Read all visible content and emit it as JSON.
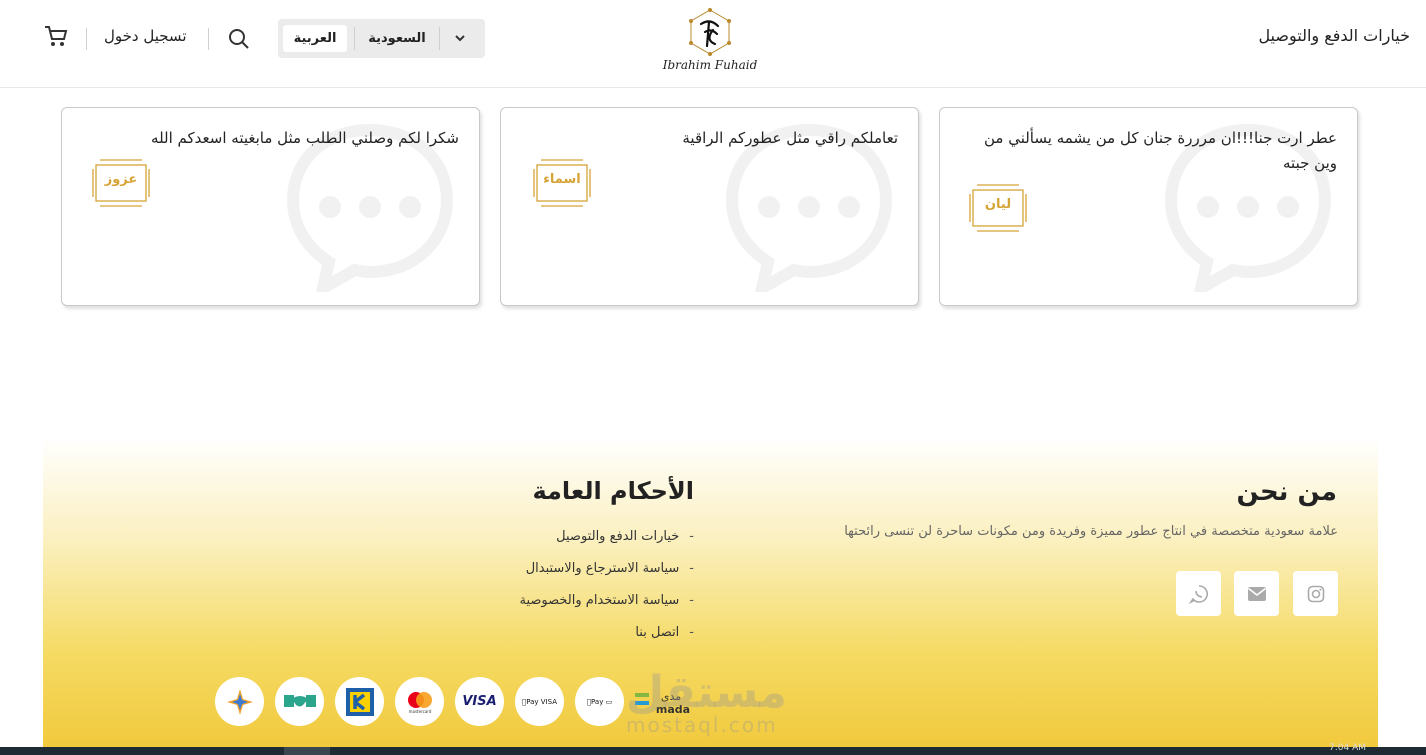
{
  "header": {
    "title": "خيارات الدفع والتوصيل",
    "logo_text": "Ibrahim Fuhaid",
    "language": "العربية",
    "country": "السعودية",
    "login": "تسجيل دخول"
  },
  "reviews": [
    {
      "text": "عطر ارت جنا!!!ان مرررة جنان كل من يشمه يسألني من وين جبته",
      "name": "ليان"
    },
    {
      "text": "تعاملكم راقي مثل عطوركم الراقية",
      "name": "اسماء"
    },
    {
      "text": "شكرا لكم وصلني الطلب مثل مابغيته اسعدكم الله",
      "name": "عزوز"
    }
  ],
  "footer": {
    "about_title": "من نحن",
    "about_desc": "علامة سعودية متخصصة في انتاج عطور مميزة وفريدة ومن مكونات ساحرة لن تنسى رائحتها",
    "social": [
      "instagram-icon",
      "email-icon",
      "whatsapp-icon"
    ],
    "terms_title": "الأحكام العامة",
    "terms": [
      "خيارات الدفع والتوصيل",
      "سياسة الاسترجاع والاستبدال",
      "سياسة الاستخدام والخصوصية",
      "اتصل بنا"
    ],
    "payments": {
      "mada": "mada",
      "mada_ar": "مدى",
      "apple_pay": "Pay",
      "visa": "VISA",
      "mastercard": "mastercard"
    },
    "watermark": "مستقل",
    "watermark_url": "mostaql.com"
  },
  "taskbar": {
    "clock": "7:04 AM"
  },
  "colors": {
    "gold": "#d6a436",
    "footer_yellow": "#f1c83a"
  }
}
